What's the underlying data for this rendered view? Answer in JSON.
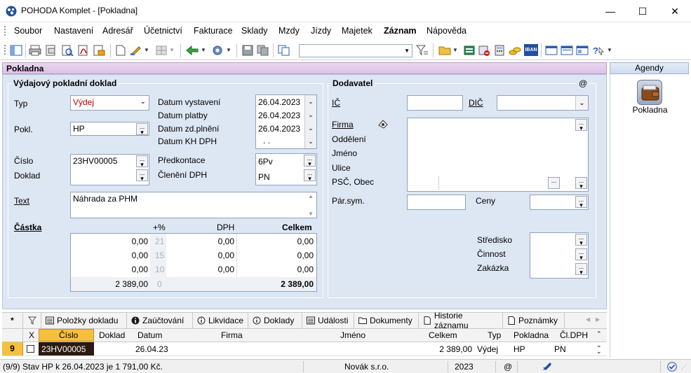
{
  "window": {
    "title": "POHODA Komplet - [Pokladna]",
    "minimize_glyph": "—",
    "maximize_glyph": "☐",
    "close_glyph": "✕"
  },
  "menu": {
    "items": [
      "Soubor",
      "Nastavení",
      "Adresář",
      "Účetnictví",
      "Fakturace",
      "Sklady",
      "Mzdy",
      "Jízdy",
      "Majetek",
      "Záznam",
      "Nápověda"
    ],
    "active_index": 9
  },
  "toolbar": {
    "search_placeholder": "",
    "icons": [
      "panel-icon",
      "print-icon",
      "print-preview-icon",
      "print-setup-icon",
      "pdf-icon",
      "export-icon",
      "new-record-icon",
      "edit-icon",
      "grid-icon",
      "back-icon",
      "settings-icon",
      "save-icon",
      "copy-icon",
      "duplicate-icon",
      "filter-icon",
      "folder-icon",
      "accounting-icon",
      "remove-icon",
      "calculator-icon",
      "coins-icon",
      "iban-icon",
      "window-icon",
      "window2-icon",
      "window3-icon",
      "help-icon"
    ],
    "iban_label": "IBAN"
  },
  "section_title": "Pokladna",
  "agendy": {
    "header": "Agendy",
    "item_label": "Pokladna"
  },
  "doc_group": {
    "title": "Výdajový pokladní doklad",
    "typ_label": "Typ",
    "typ_value": "Výdej",
    "pokl_label": "Pokl.",
    "pokl_value": "HP",
    "cislo_label": "Číslo",
    "cislo_value": "23HV00005",
    "doklad_label": "Doklad",
    "text_label": "Text",
    "text_value": "Náhrada za PHM",
    "datum_vystaveni_label": "Datum vystavení",
    "datum_vystaveni": "26.04.2023",
    "datum_platby_label": "Datum platby",
    "datum_platby": "26.04.2023",
    "datum_zdp_label": "Datum zd.plnění",
    "datum_zdp": "26.04.2023",
    "datum_kh_label": "Datum KH DPH",
    "datum_kh": ". .",
    "predkontace_label": "Předkontace",
    "predkontace_value": "6Pv",
    "cleneni_label": "Členění DPH",
    "cleneni_value": "PN"
  },
  "amounts": {
    "castka_label": "Částka",
    "rate_header": "+%",
    "dph_header": "DPH",
    "celkem_header": "Celkem",
    "rows": [
      {
        "base": "0,00",
        "rate": "21",
        "dph": "0,00",
        "total": "0,00"
      },
      {
        "base": "0,00",
        "rate": "15",
        "dph": "0,00",
        "total": "0,00"
      },
      {
        "base": "0,00",
        "rate": "10",
        "dph": "0,00",
        "total": "0,00"
      },
      {
        "base": "2 389,00",
        "rate": "0",
        "dph": "",
        "total": "2 389,00"
      }
    ]
  },
  "supplier": {
    "title": "Dodavatel",
    "at_sign": "@",
    "ic_label": "IČ",
    "dic_label": "DIČ",
    "firma_label": "Firma",
    "oddeleni_label": "Oddělení",
    "jmeno_label": "Jméno",
    "ulice_label": "Ulice",
    "psc_label": "PSČ, Obec",
    "parsym_label": "Pár.sym.",
    "ceny_label": "Ceny",
    "stredisko_label": "Středisko",
    "cinnost_label": "Činnost",
    "zakazka_label": "Zakázka"
  },
  "tabs": {
    "star": "*",
    "items": [
      "Položky dokladu",
      "Zaúčtování",
      "Likvidace",
      "Doklady",
      "Události",
      "Dokumenty",
      "Historie záznamu",
      "Poznámky"
    ],
    "icons": [
      "list-icon",
      "info-icon",
      "info-icon",
      "info-icon",
      "list-icon",
      "folder-icon",
      "document-icon",
      "document-icon"
    ]
  },
  "grid": {
    "columns": [
      "X",
      "Číslo",
      "Doklad",
      "Datum",
      "Firma",
      "Jméno",
      "Celkem",
      "Typ",
      "Pokladna",
      "Čl.DPH"
    ],
    "row": {
      "index": "9",
      "cislo": "23HV00005",
      "doklad": "",
      "datum": "26.04.23",
      "firma": "",
      "jmeno": "",
      "celkem": "2 389,00",
      "typ": "Výdej",
      "pokladna": "HP",
      "cl_dph": "PN"
    }
  },
  "status": {
    "left": "(9/9) Stav HP k 26.04.2023 je 1 791,00 Kč.",
    "company": "Novák  s.r.o.",
    "year": "2023",
    "at": "@"
  },
  "colors": {
    "form_bg": "#dde6f3",
    "section_header": "#e3cdea",
    "selected_cell": "#2b1a10",
    "required_text": "#c00000"
  }
}
